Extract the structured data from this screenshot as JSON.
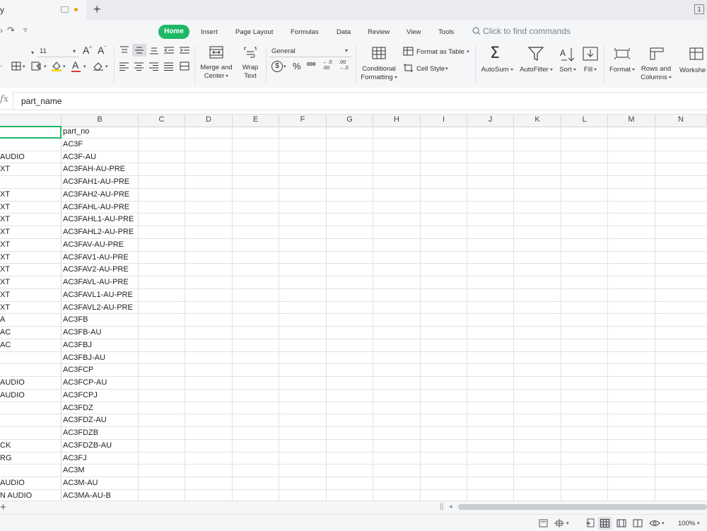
{
  "tabs": {
    "doc_label": "y",
    "new_tab": "+",
    "window_badge": "1"
  },
  "quick_access": {
    "redo": "↷",
    "more": "▿"
  },
  "menu": {
    "home": "Home",
    "insert": "Insert",
    "page_layout": "Page Layout",
    "formulas": "Formulas",
    "data": "Data",
    "review": "Review",
    "view": "View",
    "tools": "Tools",
    "search": "Click to find commands"
  },
  "ribbon": {
    "font_size": "11",
    "merge_center": "Merge and",
    "merge_center2": "Center",
    "wrap_text": "Wrap",
    "wrap_text2": "Text",
    "number_format": "General",
    "currency": "$",
    "percent": "%",
    "thousands": "000",
    "dec_inc": "←.0\n.00",
    "dec_dec": ".00\n→.0",
    "conditional": "Conditional",
    "conditional2": "Formatting",
    "format_table": "Format as Table",
    "cell_style": "Cell Style",
    "autosum": "AutoSum",
    "autofilter": "AutoFilter",
    "sort": "Sort",
    "fill": "Fill",
    "format": "Format",
    "rows_cols": "Rows and",
    "rows_cols2": "Columns",
    "worksheet": "Workshe"
  },
  "formula_bar": {
    "fx": "fx",
    "value": "part_name"
  },
  "columns": [
    "B",
    "C",
    "D",
    "E",
    "F",
    "G",
    "H",
    "I",
    "J",
    "K",
    "L",
    "M",
    "N"
  ],
  "rows": [
    {
      "a": "",
      "b": "part_no"
    },
    {
      "a": "",
      "b": "AC3F"
    },
    {
      "a": "AUDIO",
      "b": "AC3F-AU"
    },
    {
      "a": "XT",
      "b": "AC3FAH-AU-PRE"
    },
    {
      "a": "",
      "b": "AC3FAH1-AU-PRE"
    },
    {
      "a": "XT",
      "b": "AC3FAH2-AU-PRE"
    },
    {
      "a": "XT",
      "b": "AC3FAHL-AU-PRE"
    },
    {
      "a": "XT",
      "b": "AC3FAHL1-AU-PRE"
    },
    {
      "a": "XT",
      "b": "AC3FAHL2-AU-PRE"
    },
    {
      "a": "XT",
      "b": "AC3FAV-AU-PRE"
    },
    {
      "a": "XT",
      "b": "AC3FAV1-AU-PRE"
    },
    {
      "a": "XT",
      "b": "AC3FAV2-AU-PRE"
    },
    {
      "a": "XT",
      "b": "AC3FAVL-AU-PRE"
    },
    {
      "a": "XT",
      "b": "AC3FAVL1-AU-PRE"
    },
    {
      "a": "XT",
      "b": "AC3FAVL2-AU-PRE"
    },
    {
      "a": "A",
      "b": "AC3FB"
    },
    {
      "a": "AC",
      "b": "AC3FB-AU"
    },
    {
      "a": "AC",
      "b": "AC3FBJ"
    },
    {
      "a": "",
      "b": "AC3FBJ-AU"
    },
    {
      "a": "",
      "b": "AC3FCP"
    },
    {
      "a": "AUDIO",
      "b": "AC3FCP-AU"
    },
    {
      "a": "AUDIO",
      "b": "AC3FCPJ"
    },
    {
      "a": "",
      "b": "AC3FDZ"
    },
    {
      "a": "",
      "b": "AC3FDZ-AU"
    },
    {
      "a": "",
      "b": "AC3FDZB"
    },
    {
      "a": "CK",
      "b": "AC3FDZB-AU"
    },
    {
      "a": "RG",
      "b": "AC3FJ"
    },
    {
      "a": "",
      "b": "AC3M"
    },
    {
      "a": "AUDIO",
      "b": "AC3M-AU"
    },
    {
      "a": "N AUDIO",
      "b": "AC3MA-AU-B"
    }
  ],
  "status": {
    "zoom": "100%",
    "add_sheet": "+"
  },
  "colors": {
    "accent": "#1fb866",
    "ribbon_bg": "#f5f6f7"
  }
}
